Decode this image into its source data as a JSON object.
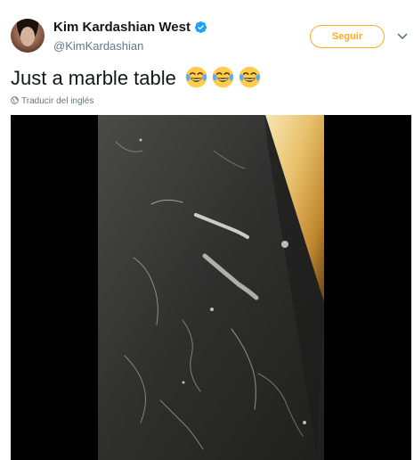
{
  "author": {
    "display_name": "Kim Kardashian West",
    "handle": "@KimKardashian",
    "verified": true
  },
  "actions": {
    "follow_label": "Seguir",
    "more_icon": "chevron-down-icon"
  },
  "tweet": {
    "text": "Just a marble table",
    "emojis": [
      "face-with-tears-of-joy",
      "face-with-tears-of-joy",
      "face-with-tears-of-joy"
    ],
    "translate_label": "Traducir del inglés"
  },
  "colors": {
    "accent": "#ffad1f",
    "verified": "#1da1f2",
    "secondary_text": "#657786"
  }
}
